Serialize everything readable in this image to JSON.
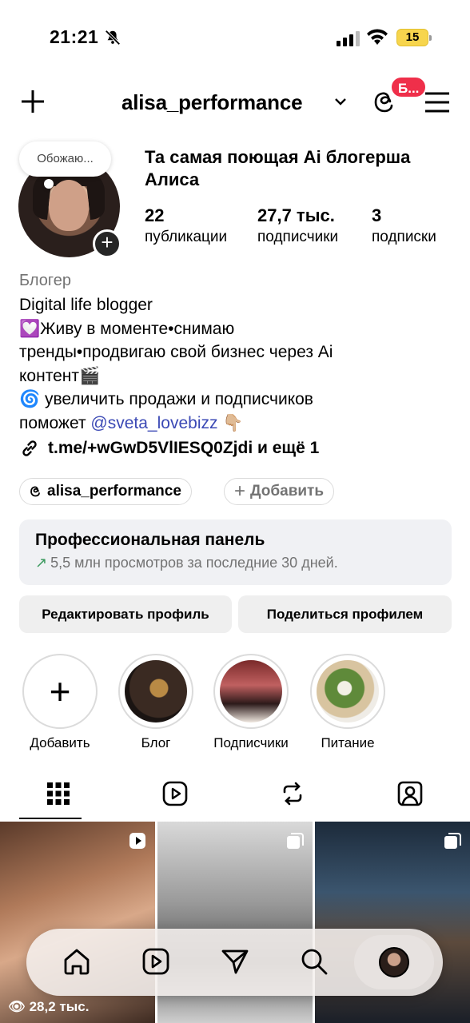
{
  "status_bar": {
    "time": "21:21",
    "battery": "15"
  },
  "header": {
    "username": "alisa_performance",
    "badge": "Б..."
  },
  "profile": {
    "note": "Обожаю...",
    "display_name": "Та самая поющая Ai блогерша Алиса",
    "stats": [
      {
        "value": "22",
        "label": "публикации"
      },
      {
        "value": "27,7 тыс.",
        "label": "подписчики"
      },
      {
        "value": "3",
        "label": "подписки"
      }
    ],
    "category": "Блогер",
    "bio_line1": "Digital life blogger",
    "bio_line2": "💟Живу в моменте•снимаю",
    "bio_line3": "тренды•продвигаю свой бизнес через Ai",
    "bio_line4": "контент🎬",
    "bio_line5": "🌀 увеличить продажи и подписчиков",
    "bio_line6_prefix": "поможет ",
    "bio_mention": "@sveta_lovebizz",
    "bio_line6_suffix": " 👇🏼",
    "link": "t.me/+wGwD5VlIESQ0Zjdi и ещё 1"
  },
  "pills": {
    "threads": "alisa_performance",
    "add": "Добавить"
  },
  "pro_panel": {
    "title": "Профессиональная панель",
    "subtitle": "5,5 млн просмотров за последние 30 дней."
  },
  "buttons": {
    "edit": "Редактировать профиль",
    "share": "Поделиться профилем"
  },
  "highlights": [
    {
      "label": "Добавить"
    },
    {
      "label": "Блог"
    },
    {
      "label": "Подписчики"
    },
    {
      "label": "Питание"
    }
  ],
  "grid": {
    "first_views": "28,2 тыс."
  },
  "icons": [
    "bell-off-icon",
    "signal-icon",
    "wifi-icon",
    "plus-icon",
    "chevron-down-icon",
    "threads-icon",
    "menu-icon",
    "link-icon",
    "grid-icon",
    "reels-icon",
    "reposts-icon",
    "tagged-icon",
    "home-icon",
    "search-icon",
    "send-icon"
  ]
}
